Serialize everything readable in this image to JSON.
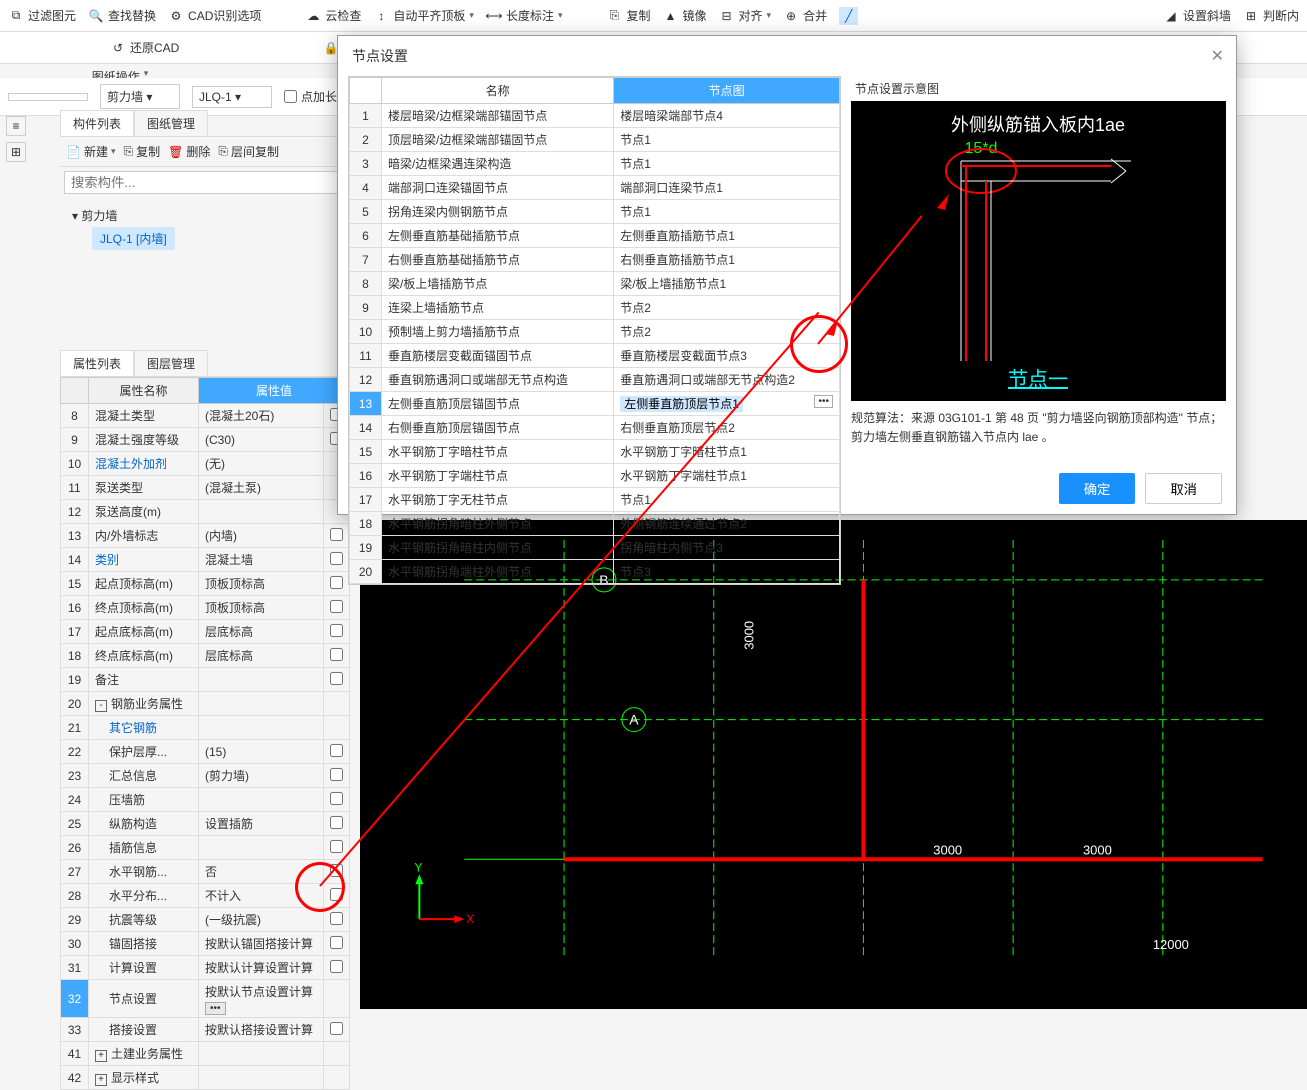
{
  "toolbar": {
    "filter": "过滤图元",
    "findreplace": "查找替换",
    "cadoptions": "CAD识别选项",
    "cloudcheck": "云检查",
    "autolevel": "自动平齐顶板",
    "lengthdim": "长度标注",
    "copy": "复制",
    "mirror": "镜像",
    "align": "对齐",
    "merge": "合并",
    "slope": "设置斜墙",
    "judge": "判断内",
    "restorecad": "还原CAD",
    "lock": "锁定",
    "drawingops": "图纸操作"
  },
  "selectors": {
    "type1": "剪力墙",
    "type2": "JLQ-1",
    "addlength": "点加长度 长"
  },
  "componentlist": {
    "tab1": "构件列表",
    "tab2": "图纸管理",
    "new": "新建",
    "copy": "复制",
    "delete": "删除",
    "layercopy": "层间复制",
    "search_placeholder": "搜索构件...",
    "root": "剪力墙",
    "child": "JLQ-1 [内墙]"
  },
  "props": {
    "tab1": "属性列表",
    "tab2": "图层管理",
    "col_name": "属性名称",
    "col_value": "属性值",
    "rows": [
      {
        "n": "8",
        "name": "混凝土类型",
        "value": "(混凝土20石)",
        "chk": true
      },
      {
        "n": "9",
        "name": "混凝土强度等级",
        "value": "(C30)",
        "chk": true
      },
      {
        "n": "10",
        "name": "混凝土外加剂",
        "value": "(无)",
        "blue": true
      },
      {
        "n": "11",
        "name": "泵送类型",
        "value": "(混凝土泵)"
      },
      {
        "n": "12",
        "name": "泵送高度(m)",
        "value": ""
      },
      {
        "n": "13",
        "name": "内/外墙标志",
        "value": "(内墙)",
        "chk": true
      },
      {
        "n": "14",
        "name": "类别",
        "value": "混凝土墙",
        "blue": true,
        "chk": true
      },
      {
        "n": "15",
        "name": "起点顶标高(m)",
        "value": "顶板顶标高",
        "chk": true
      },
      {
        "n": "16",
        "name": "终点顶标高(m)",
        "value": "顶板顶标高",
        "chk": true
      },
      {
        "n": "17",
        "name": "起点底标高(m)",
        "value": "层底标高",
        "chk": true
      },
      {
        "n": "18",
        "name": "终点底标高(m)",
        "value": "层底标高",
        "chk": true
      },
      {
        "n": "19",
        "name": "备注",
        "value": "",
        "chk": true
      },
      {
        "n": "20",
        "name": "钢筋业务属性",
        "value": "",
        "group": true,
        "exp": "-"
      },
      {
        "n": "21",
        "name": "其它钢筋",
        "value": "",
        "indent": true,
        "blue": true
      },
      {
        "n": "22",
        "name": "保护层厚...",
        "value": "(15)",
        "indent": true,
        "chk": true
      },
      {
        "n": "23",
        "name": "汇总信息",
        "value": "(剪力墙)",
        "indent": true,
        "chk": true
      },
      {
        "n": "24",
        "name": "压墙筋",
        "value": "",
        "indent": true,
        "chk": true
      },
      {
        "n": "25",
        "name": "纵筋构造",
        "value": "设置插筋",
        "indent": true,
        "chk": true
      },
      {
        "n": "26",
        "name": "插筋信息",
        "value": "",
        "indent": true,
        "chk": true
      },
      {
        "n": "27",
        "name": "水平钢筋...",
        "value": "否",
        "indent": true,
        "chk": true
      },
      {
        "n": "28",
        "name": "水平分布...",
        "value": "不计入",
        "indent": true,
        "chk": true
      },
      {
        "n": "29",
        "name": "抗震等级",
        "value": "(一级抗震)",
        "indent": true,
        "chk": true
      },
      {
        "n": "30",
        "name": "锚固搭接",
        "value": "按默认锚固搭接计算",
        "indent": true,
        "chk": true
      },
      {
        "n": "31",
        "name": "计算设置",
        "value": "按默认计算设置计算",
        "indent": true,
        "chk": true
      },
      {
        "n": "32",
        "name": "节点设置",
        "value": "按默认节点设置计算",
        "indent": true,
        "hl": true,
        "more": true
      },
      {
        "n": "33",
        "name": "搭接设置",
        "value": "按默认搭接设置计算",
        "indent": true,
        "chk": true
      },
      {
        "n": "41",
        "name": "土建业务属性",
        "value": "",
        "group": true,
        "exp": "+"
      },
      {
        "n": "42",
        "name": "显示样式",
        "value": "",
        "group": true,
        "exp": "+"
      }
    ]
  },
  "modal": {
    "title": "节点设置",
    "col_name": "名称",
    "col_img": "节点图",
    "rows": [
      {
        "n": "1",
        "name": "楼层暗梁/边框梁端部锚固节点",
        "val": "楼层暗梁端部节点4"
      },
      {
        "n": "2",
        "name": "顶层暗梁/边框梁端部锚固节点",
        "val": "节点1"
      },
      {
        "n": "3",
        "name": "暗梁/边框梁遇连梁构造",
        "val": "节点1"
      },
      {
        "n": "4",
        "name": "端部洞口连梁锚固节点",
        "val": "端部洞口连梁节点1"
      },
      {
        "n": "5",
        "name": "拐角连梁内侧钢筋节点",
        "val": "节点1"
      },
      {
        "n": "6",
        "name": "左侧垂直筋基础插筋节点",
        "val": "左侧垂直筋插筋节点1"
      },
      {
        "n": "7",
        "name": "右侧垂直筋基础插筋节点",
        "val": "右侧垂直筋插筋节点1"
      },
      {
        "n": "8",
        "name": "梁/板上墙插筋节点",
        "val": "梁/板上墙插筋节点1"
      },
      {
        "n": "9",
        "name": "连梁上墙插筋节点",
        "val": "节点2"
      },
      {
        "n": "10",
        "name": "预制墙上剪力墙插筋节点",
        "val": "节点2"
      },
      {
        "n": "11",
        "name": "垂直筋楼层变截面锚固节点",
        "val": "垂直筋楼层变截面节点3"
      },
      {
        "n": "12",
        "name": "垂直钢筋遇洞口或端部无节点构造",
        "val": "垂直筋遇洞口或端部无节点构造2"
      },
      {
        "n": "13",
        "name": "左侧垂直筋顶层锚固节点",
        "val": "左侧垂直筋顶层节点1",
        "sel": true
      },
      {
        "n": "14",
        "name": "右侧垂直筋顶层锚固节点",
        "val": "右侧垂直筋顶层节点2"
      },
      {
        "n": "15",
        "name": "水平钢筋丁字暗柱节点",
        "val": "水平钢筋丁字暗柱节点1"
      },
      {
        "n": "16",
        "name": "水平钢筋丁字端柱节点",
        "val": "水平钢筋丁字端柱节点1"
      },
      {
        "n": "17",
        "name": "水平钢筋丁字无柱节点",
        "val": "节点1"
      },
      {
        "n": "18",
        "name": "水平钢筋拐角暗柱外侧节点",
        "val": "外侧钢筋连续通过节点2"
      },
      {
        "n": "19",
        "name": "水平钢筋拐角暗柱内侧节点",
        "val": "拐角暗柱内侧节点3"
      },
      {
        "n": "20",
        "name": "水平钢筋拐角端柱外侧节点",
        "val": "节点3"
      }
    ],
    "preview_title": "节点设置示意图",
    "preview_text1": "外侧纵筋锚入板内1ae",
    "preview_text2": "15*d",
    "preview_text3": "节点一",
    "preview_desc": "规范算法：来源 03G101-1 第 48 页 \"剪力墙竖向钢筋顶部构造\" 节点；剪力墙左侧垂直钢筋锚入节点内 lae 。",
    "ok": "确定",
    "cancel": "取消"
  },
  "canvas": {
    "dim1": "3000",
    "dim2": "3000",
    "dim3": "3000",
    "dim4": "12000",
    "axis_a": "A",
    "axis_b": "B",
    "x": "X",
    "y": "Y"
  }
}
